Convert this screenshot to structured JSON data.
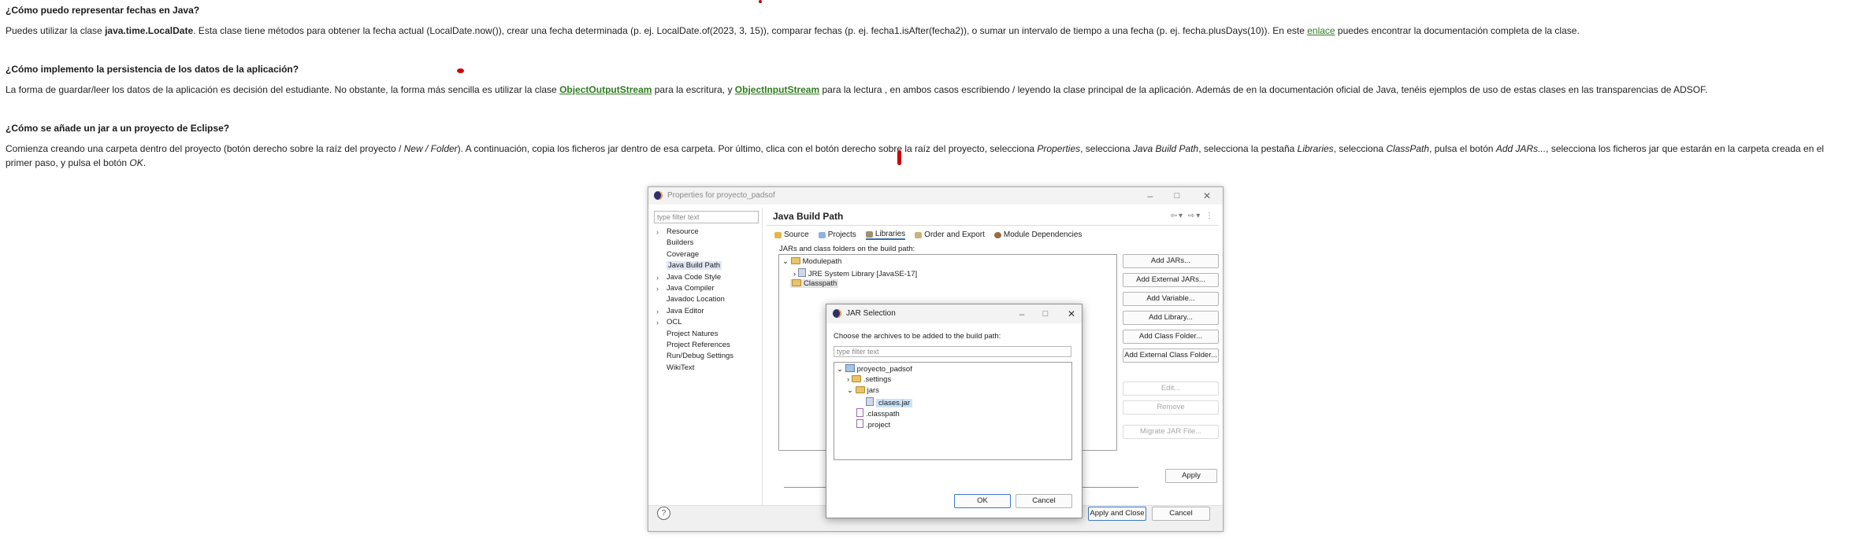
{
  "faq": [
    {
      "question": "¿Cómo puedo representar fechas en Java?",
      "answer_parts": {
        "pre": "Puedes utilizar la clase ",
        "bold": "java.time.LocalDate",
        "mid": ". Esta clase tiene métodos para obtener la fecha actual (LocalDate.now()), crear una fecha determinada (p. ej. LocalDate.of(2023, 3, 15)), comparar fechas (p. ej. fecha1.isAfter(fecha2)), o sumar un intervalo de tiempo a una fecha (p. ej. fecha.plusDays(10)). En este ",
        "link": "enlace",
        "post": " puedes encontrar la documentación completa de la clase."
      }
    },
    {
      "question": "¿Cómo implemento la persistencia de los datos de la aplicación?",
      "answer_parts": {
        "pre": "La forma de guardar/leer los datos de la aplicación es decisión del estudiante. No obstante, la forma más sencilla es utilizar la clase ",
        "link1": "ObjectOutputStream",
        "mid": " para la escritura, y ",
        "link2": "ObjectInputStream",
        "post": " para la lectura , en ambos casos escribiendo / leyendo la clase principal de la aplicación. Además de en la documentación oficial de Java, tenéis ejemplos de uso de estas clases en las transparencias de ADSOF."
      }
    },
    {
      "question": "¿Cómo se añade un jar a un proyecto de Eclipse?",
      "answer_parts": {
        "t1": "Comienza creando una carpeta dentro del proyecto (botón derecho sobre la raíz del proyecto / ",
        "i1": "New / Folder",
        "t2": "). A continuación, copia los ficheros jar dentro de esa carpeta. Por último,  clica con el botón derecho sobre la raíz del proyecto, selecciona ",
        "i2": "Properties",
        "t3": ", selecciona ",
        "i3": "Java Build Path",
        "t4": ", selecciona la pestaña ",
        "i4": "Libraries",
        "t5": ", selecciona ",
        "i5": "ClassPath",
        "t6": ", pulsa el botón ",
        "i6": "Add JARs...",
        "t7": ", selecciona los ficheros jar que estarán en la carpeta creada en el primer paso, y pulsa el botón ",
        "i7": "OK",
        "t8": "."
      }
    }
  ],
  "properties_window": {
    "title": "Properties for proyecto_padsof",
    "filter_placeholder": "type filter text",
    "tree": [
      {
        "label": "Resource",
        "expandable": true
      },
      {
        "label": "Builders",
        "expandable": false
      },
      {
        "label": "Coverage",
        "expandable": false
      },
      {
        "label": "Java Build Path",
        "expandable": false,
        "selected": true
      },
      {
        "label": "Java Code Style",
        "expandable": true
      },
      {
        "label": "Java Compiler",
        "expandable": true
      },
      {
        "label": "Javadoc Location",
        "expandable": false
      },
      {
        "label": "Java Editor",
        "expandable": true
      },
      {
        "label": "OCL",
        "expandable": true
      },
      {
        "label": "Project Natures",
        "expandable": false
      },
      {
        "label": "Project References",
        "expandable": false
      },
      {
        "label": "Run/Debug Settings",
        "expandable": false
      },
      {
        "label": "WikiText",
        "expandable": false
      }
    ],
    "page_title": "Java Build Path",
    "tabs": [
      "Source",
      "Projects",
      "Libraries",
      "Order and Export",
      "Module Dependencies"
    ],
    "jar_label": "JARs and class folders on the build path:",
    "classpath_tree": {
      "modulepath": "Modulepath",
      "jre": "JRE System Library [JavaSE-17]",
      "classpath": "Classpath"
    },
    "side_buttons": [
      {
        "label": "Add JARs...",
        "enabled": true
      },
      {
        "label": "Add External JARs...",
        "enabled": true
      },
      {
        "label": "Add Variable...",
        "enabled": true
      },
      {
        "label": "Add Library...",
        "enabled": true
      },
      {
        "label": "Add Class Folder...",
        "enabled": true
      },
      {
        "label": "Add External Class Folder...",
        "enabled": true
      },
      {
        "label": "Edit...",
        "enabled": false
      },
      {
        "label": "Remove",
        "enabled": false
      },
      {
        "label": "Migrate JAR File...",
        "enabled": false
      }
    ],
    "apply_label": "Apply",
    "apply_close_label": "Apply and Close",
    "cancel_label": "Cancel",
    "help_label": "?"
  },
  "jar_dialog": {
    "title": "JAR Selection",
    "prompt": "Choose the archives to be added to the build path:",
    "filter_placeholder": "type filter text",
    "tree": {
      "project": "proyecto_padsof",
      "settings": ".settings",
      "jars": "jars",
      "jar_file": "clases.jar",
      "classpath": ".classpath",
      "project_file": ".project"
    },
    "ok_label": "OK",
    "cancel_label": "Cancel"
  },
  "colors": {
    "link": "#2f7d1f",
    "selection": "#cde3f7",
    "annotation": "#d00000"
  }
}
